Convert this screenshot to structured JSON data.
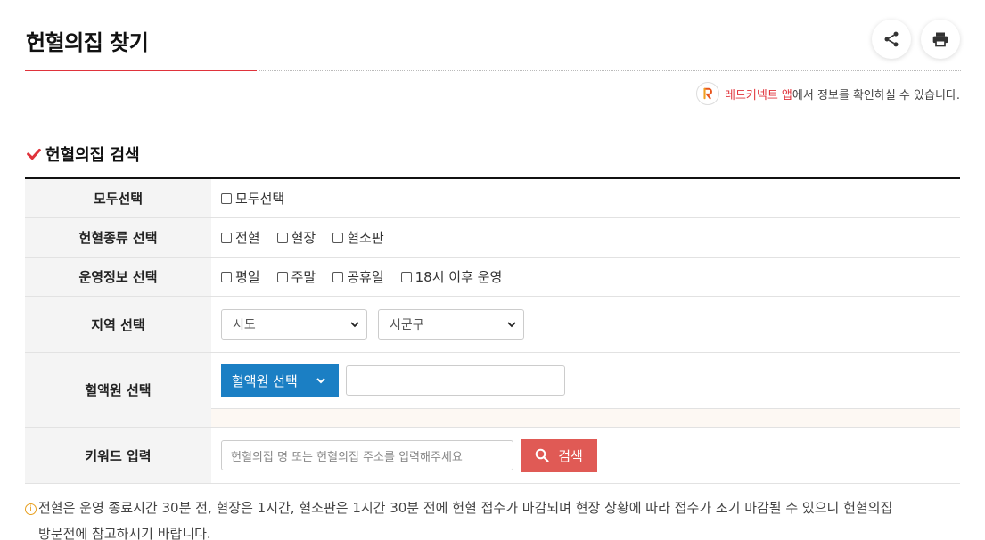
{
  "header": {
    "title": "헌혈의집 찾기",
    "share_icon": "share-icon",
    "print_icon": "print-icon"
  },
  "app_note": {
    "link_text": "레드커넥트 앱",
    "rest_text": "에서 정보를 확인하실 수 있습니다.",
    "accent_color": "#e0333b"
  },
  "section": {
    "title": "헌혈의집 검색"
  },
  "form": {
    "select_all": {
      "label": "모두선택",
      "option": "모두선택"
    },
    "donation_type": {
      "label": "헌혈종류 선택",
      "options": [
        "전혈",
        "혈장",
        "혈소판"
      ]
    },
    "operation_info": {
      "label": "운영정보 선택",
      "options": [
        "평일",
        "주말",
        "공휴일",
        "18시 이후 운영"
      ]
    },
    "region": {
      "label": "지역 선택",
      "sido": "시도",
      "sigungu": "시군구"
    },
    "blood_center": {
      "label": "혈액원 선택",
      "button": "혈액원 선택",
      "input_value": ""
    },
    "keyword": {
      "label": "키워드 입력",
      "placeholder": "헌혈의집 명 또는 헌혈의집 주소를 입력해주세요",
      "search_button": "검색"
    }
  },
  "notice": {
    "line1": "전혈은 운영 종료시간 30분 전, 혈장은 1시간, 혈소판은 1시간 30분 전에 헌혈 접수가 마감되며 현장 상황에 따라 접수가 조기 마감될 수 있으니 헌혈의집",
    "line2": "방문전에 참고하시기 바랍니다."
  },
  "colors": {
    "accent": "#e0333b",
    "primary_blue": "#1b7fc4",
    "search_red": "#e05a55"
  }
}
